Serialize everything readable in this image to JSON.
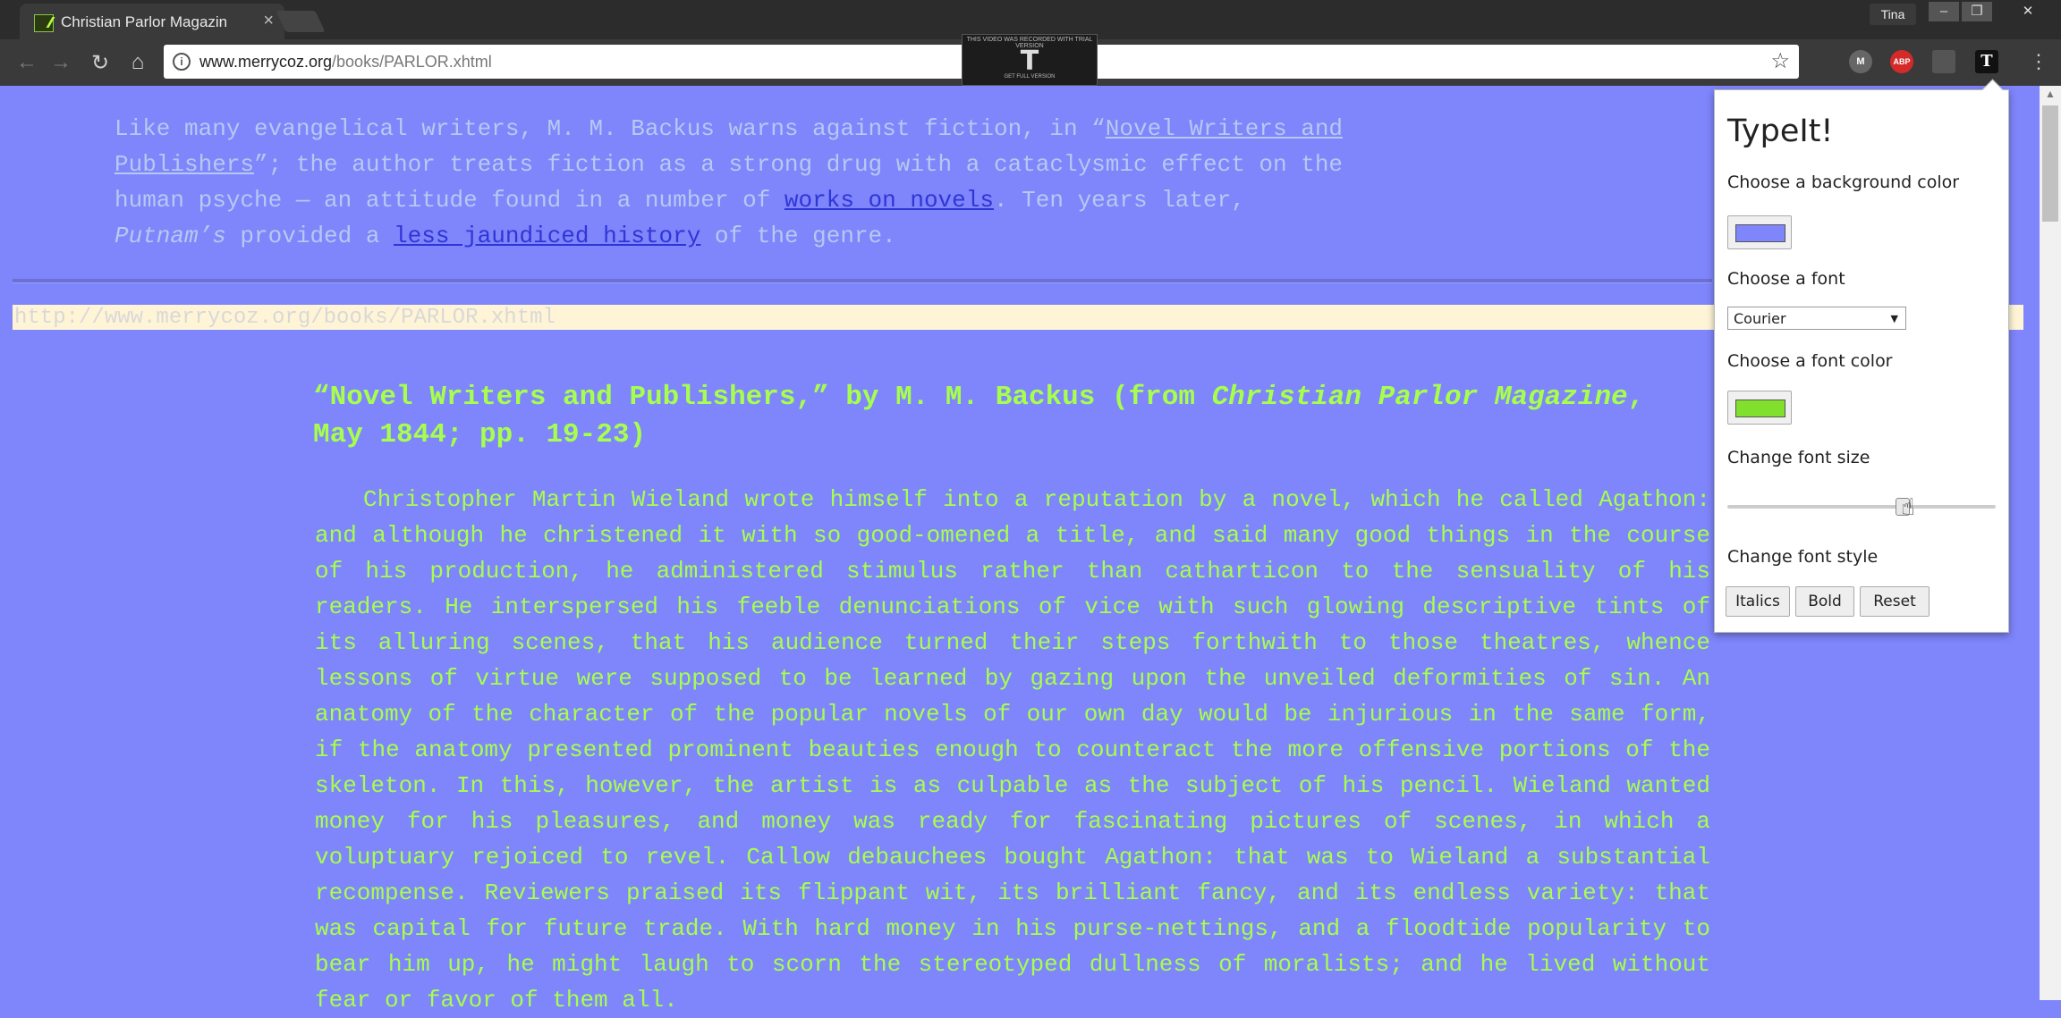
{
  "browser": {
    "tab_title": "Christian Parlor Magazin",
    "tab_close": "×",
    "profile_name": "Tina",
    "window_controls": [
      "–",
      "❐",
      "✕"
    ],
    "nav_icons": [
      "back-icon",
      "forward-icon",
      "reload-icon",
      "home-icon"
    ],
    "nav_glyphs": [
      "←",
      "→",
      "↻",
      "⌂"
    ],
    "url_domain": "www.merrycoz.org",
    "url_path": "/books/PARLOR.xhtml",
    "bookmark_glyph": "☆",
    "extensions": [
      "M",
      "ABP",
      "",
      "T"
    ],
    "menu_glyph": "⋮",
    "watermark": {
      "top_text": "THIS VIDEO WAS RECORDED WITH TRIAL VERSION",
      "logo": "T",
      "bottom_text": "GET FULL VERSION"
    }
  },
  "page": {
    "background": "#7f85fb",
    "intro": {
      "t1": "Like many evangelical writers, M. M. Backus warns against fiction, in “",
      "link1": "Novel Writers and Publishers",
      "t2": "”; the author treats fiction as a strong drug with a cataclysmic effect on the human psyche — an attitude found in a number of ",
      "link2": "works on novels",
      "t3": ". Ten years later, ",
      "em": "Putnam’s",
      "t4": " provided a ",
      "link3": "less jaundiced history",
      "t5": " of the genre."
    },
    "url_strip": "http://www.merrycoz.org/books/PARLOR.xhtml",
    "heading": {
      "t1": "“Novel Writers and Publishers,” by M. M. Backus (from ",
      "em": "Christian Parlor Magazine",
      "t2": ", May 1844; pp. 19-23)"
    },
    "body_text": "Christopher Martin Wieland wrote himself into a reputation by a novel, which he called Agathon: and although he christened it with so good-omened a title, and said many good things in the course of his production, he administered stimulus rather than catharticon to the sensuality of his readers. He interspersed his feeble denunciations of vice with such glowing descriptive tints of its alluring scenes, that his audience turned their steps forthwith to those theatres, whence lessons of virtue were supposed to be learned by gazing upon the unveiled deformities of sin. An anatomy of the character of the popular novels of our own day would be injurious in the same form, if the anatomy presented prominent beauties enough to counteract the more offensive portions of the skeleton. In this, however, the artist is as culpable as the subject of his pencil. Wieland wanted money for his pleasures, and money was ready for fascinating pictures of scenes, in which a voluptuary rejoiced to revel. Callow debauchees bought Agathon: that was to Wieland a substantial recompense. Reviewers praised its flippant wit, its brilliant fancy, and its endless variety: that was capital for future trade. With hard money in his purse-nettings, and a floodtide popularity to bear him up, he might laugh to scorn the stereotyped dullness of moralists; and he lived without fear or favor of them all."
  },
  "popup": {
    "title": "TypeIt!",
    "bg_label": "Choose a background color",
    "bg_color": "#7f85fb",
    "font_label": "Choose a font",
    "font_value": "Courier",
    "font_color_label": "Choose a font color",
    "font_color": "#80e02c",
    "size_label": "Change font size",
    "size_value": 0.65,
    "style_label": "Change font style",
    "buttons": [
      "Italics",
      "Bold",
      "Reset"
    ]
  }
}
